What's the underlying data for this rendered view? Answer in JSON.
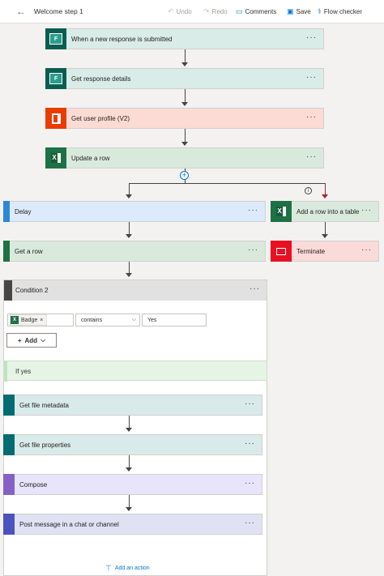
{
  "toolbar": {
    "title": "Welcome step 1",
    "undo": "Undo",
    "redo": "Redo",
    "comments": "Comments",
    "save": "Save",
    "flow_checker": "Flow checker"
  },
  "steps": {
    "trigger": "When a new response is submitted",
    "get_response": "Get response details",
    "get_user": "Get user profile (V2)",
    "update_row": "Update a row",
    "delay": "Delay",
    "add_row_table": "Add a row into a table",
    "get_row": "Get a row",
    "terminate": "Terminate",
    "condition": "Condition 2",
    "if_yes": "If yes",
    "get_file_metadata": "Get file metadata",
    "get_file_properties": "Get file properties",
    "compose": "Compose",
    "post_message": "Post message in a chat or channel"
  },
  "condition": {
    "token": "Badge",
    "operator": "contains",
    "value": "Yes",
    "add_label": "Add"
  },
  "more_label": "···",
  "add_action": "Add an action",
  "colors": {
    "accent": "#0078d4",
    "excel": "#1e7145",
    "office": "#eb3c00",
    "forms": "#0b5d51"
  }
}
